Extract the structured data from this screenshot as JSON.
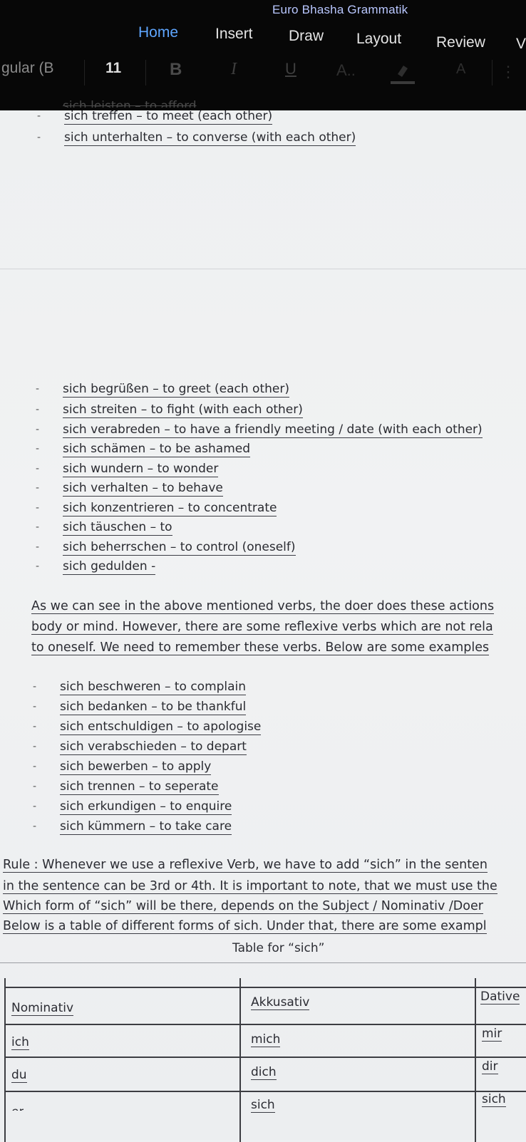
{
  "app": {
    "title": "Euro Bhasha Grammatik",
    "tabs": [
      "Home",
      "Insert",
      "Draw",
      "Layout",
      "Review",
      "V"
    ],
    "active_tab": "Home"
  },
  "format_bar": {
    "font_name": "gular (B",
    "font_size": "11",
    "bold": "B",
    "italic": "I",
    "underline": "U",
    "font_size_tool": "A..",
    "font_color_tool": "A",
    "more": "⋮"
  },
  "document": {
    "cut_line": "sich leisten – to afford",
    "top_verbs": [
      "sich treffen – to meet (each other)",
      "sich unterhalten – to converse (with each other)"
    ],
    "verbs_1": [
      "sich begrüßen – to greet (each other)",
      "sich streiten – to fight (with each other)",
      "sich verabreden – to have a friendly meeting / date (with each other)",
      "sich schämen – to be ashamed",
      "sich wundern – to wonder",
      "sich verhalten – to behave",
      "sich konzentrieren – to concentrate",
      "sich täuschen – to",
      "sich beherrschen – to control (oneself)",
      "sich gedulden -"
    ],
    "paragraph_1": [
      "As we can see in the above mentioned verbs, the doer does these actions",
      "body or mind. However, there are some reflexive verbs which are not rela",
      "to oneself. We need to remember these verbs. Below are some examples"
    ],
    "verbs_2": [
      "sich beschweren – to complain",
      "sich bedanken – to be thankful",
      "sich entschuldigen – to apologise",
      "sich verabschieden – to depart",
      "sich bewerben – to apply",
      "sich trennen – to seperate",
      "sich erkundigen – to enquire",
      "sich kümmern – to take care"
    ],
    "rule_paragraph": [
      "Rule : Whenever we use a reflexive Verb, we have to add “sich” in the senten",
      "in the sentence can be 3rd or 4th.  It is important to note, that we must use the",
      "Which form of “sich” will be there, depends on the Subject / Nominativ /Doer",
      "Below is a table of different forms of sich. Under that, there are some exampl"
    ],
    "table_title": "Table for “sich”",
    "table": {
      "headers": [
        "Nominativ",
        "Akkusativ",
        "Dative"
      ],
      "rows": [
        [
          "ich",
          "mich",
          "mir"
        ],
        [
          "du",
          "dich",
          "dir"
        ],
        [
          "er",
          "sich",
          "sich"
        ]
      ]
    }
  }
}
